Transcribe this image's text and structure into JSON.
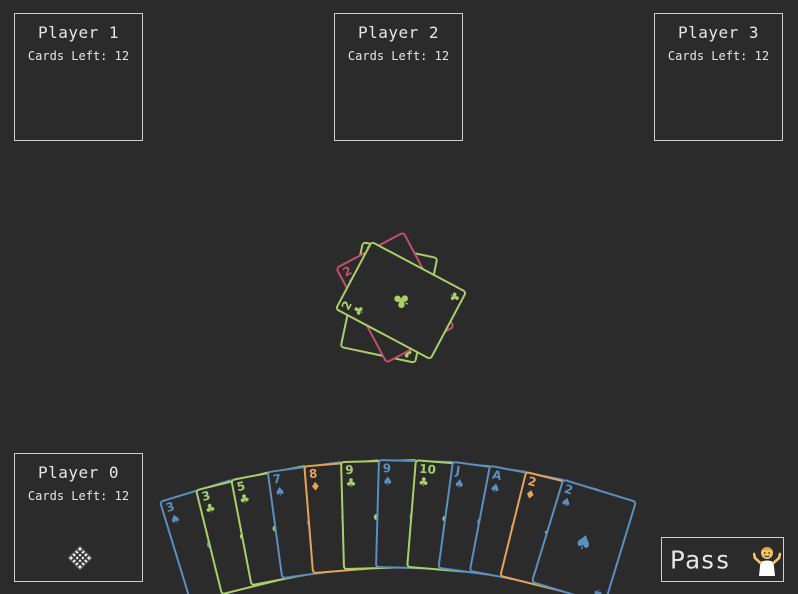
{
  "colors": {
    "background": "#2b2b2b",
    "border": "#cfcfcf",
    "spade": "#5b8fbf",
    "club": "#a8cf6a",
    "diamond": "#e6a35a",
    "heart": "#c0506e"
  },
  "players": {
    "p1": {
      "name": "Player 1",
      "cards_left": "Cards Left: 12"
    },
    "p2": {
      "name": "Player 2",
      "cards_left": "Cards Left: 12"
    },
    "p3": {
      "name": "Player 3",
      "cards_left": "Cards Left: 12"
    },
    "p0": {
      "name": "Player 0",
      "cards_left": "Cards Left: 12",
      "active_icon": "waffle-grid-icon"
    }
  },
  "pass_button": {
    "label": "Pass",
    "icon": "person-shrugging-emoji"
  },
  "pile": [
    {
      "rank": "2",
      "suit": "club"
    },
    {
      "rank": "2",
      "suit": "heart"
    },
    {
      "rank": "2",
      "suit": "club"
    }
  ],
  "hand": [
    {
      "rank": "3",
      "suit": "spade"
    },
    {
      "rank": "3",
      "suit": "club"
    },
    {
      "rank": "5",
      "suit": "club"
    },
    {
      "rank": "7",
      "suit": "spade"
    },
    {
      "rank": "8",
      "suit": "diamond"
    },
    {
      "rank": "9",
      "suit": "club"
    },
    {
      "rank": "9",
      "suit": "spade"
    },
    {
      "rank": "10",
      "suit": "club"
    },
    {
      "rank": "J",
      "suit": "spade"
    },
    {
      "rank": "A",
      "suit": "spade"
    },
    {
      "rank": "2",
      "suit": "diamond"
    },
    {
      "rank": "2",
      "suit": "spade"
    }
  ]
}
